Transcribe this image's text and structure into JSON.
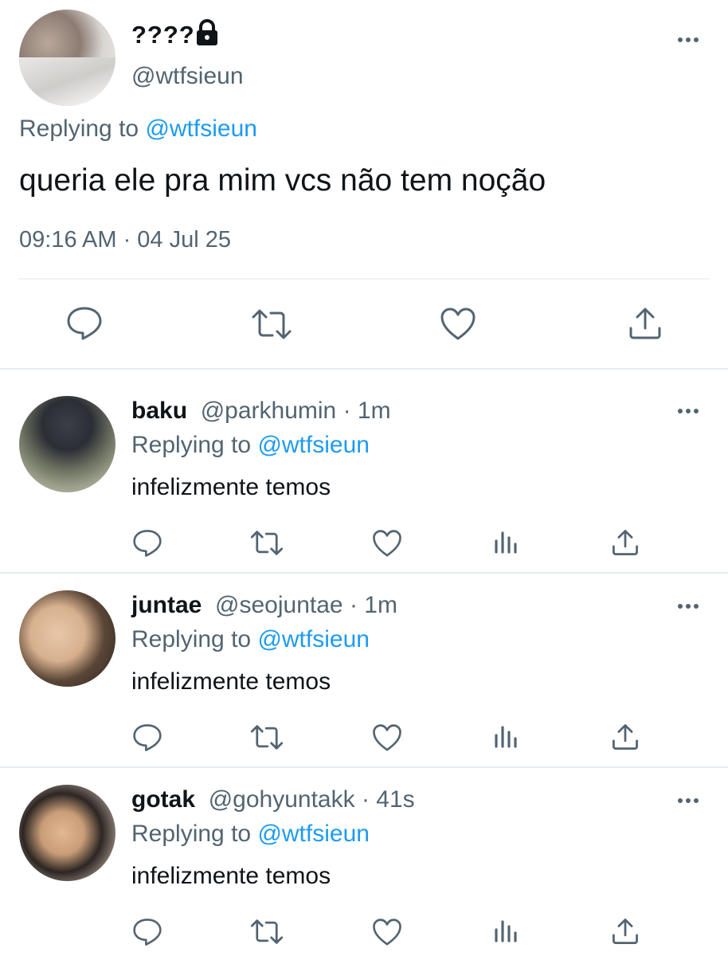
{
  "main_tweet": {
    "display_name": "????",
    "handle": "@wtfsieun",
    "replying_label": "Replying to ",
    "replying_to": "@wtfsieun",
    "text": "queria ele pra mim vcs não tem noção",
    "timestamp": "09:16 AM · 04 Jul 25"
  },
  "replies": [
    {
      "display_name": "baku",
      "handle": "@parkhumin",
      "time": "· 1m",
      "replying_label": "Replying to ",
      "replying_to": "@wtfsieun",
      "text": "infelizmente temos"
    },
    {
      "display_name": "juntae",
      "handle": "@seojuntae",
      "time": "· 1m",
      "replying_label": "Replying to ",
      "replying_to": "@wtfsieun",
      "text": "infelizmente temos"
    },
    {
      "display_name": "gotak",
      "handle": "@gohyuntakk",
      "time": "· 41s",
      "replying_label": "Replying to ",
      "replying_to": "@wtfsieun",
      "text": "infelizmente temos"
    }
  ],
  "colors": {
    "link": "#1d9bf0",
    "secondary_text": "#536471",
    "primary_text": "#0f1419",
    "divider": "#e6ecf0"
  },
  "icons": [
    "reply-icon",
    "retweet-icon",
    "like-icon",
    "views-icon",
    "share-icon",
    "more-icon",
    "lock-icon"
  ]
}
